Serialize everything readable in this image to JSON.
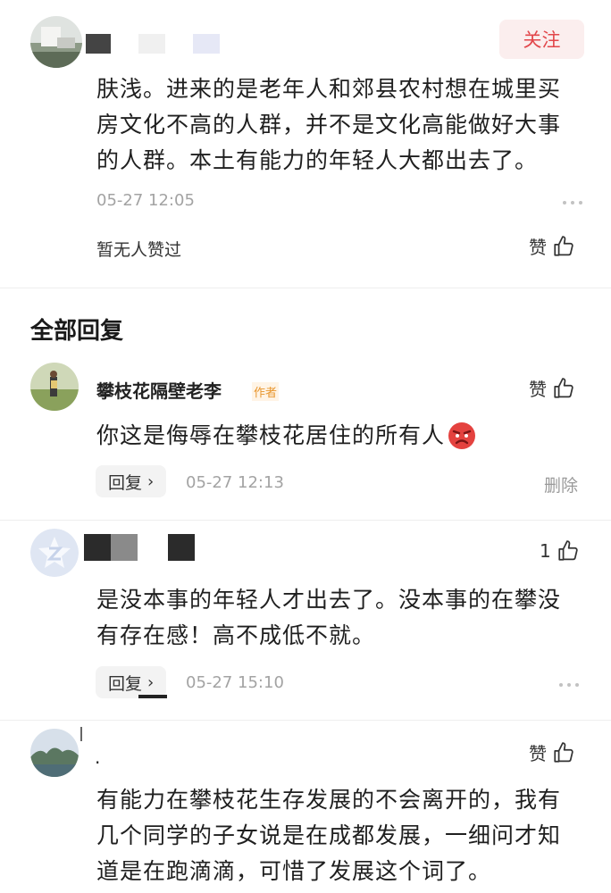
{
  "top_comment": {
    "follow_label": "关注",
    "text_lines": [
      "肤浅。进来的是老年人和郊县农村想在城里买",
      "房文化不高的人群，并不是文化高能做好大事",
      "的人群。本土有能力的年轻人大都出去了。"
    ],
    "timestamp": "05-27 12:05",
    "likes_summary": "暂无人赞过",
    "like_label": "赞"
  },
  "section_title": "全部回复",
  "replies": [
    {
      "name": "攀枝花隔壁老李",
      "author_badge": "作者",
      "like_label": "赞",
      "text_lines": [
        "你这是侮辱在攀枝花居住的所有人"
      ],
      "emoji": "angry-emoji",
      "reply_label": "回复",
      "timestamp": "05-27 12:13",
      "delete_label": "删除"
    },
    {
      "like_count": "1",
      "text_lines": [
        "是没本事的年轻人才出去了。没本事的在攀没",
        "有存在感！高不成低不就。"
      ],
      "reply_label": "回复",
      "timestamp": "05-27 15:10"
    },
    {
      "name": ".",
      "like_label": "赞",
      "text_lines": [
        "有能力在攀枝花生存发展的不会离开的，我有",
        "几个同学的子女说是在成都发展，一细问才知",
        "道是在跑滴滴，可惜了发展这个词了。"
      ]
    }
  ],
  "icons": [
    "thumbs-up-icon",
    "chevron-right-icon",
    "more-dots-icon",
    "angry-emoji"
  ],
  "colors": {
    "follow_text": "#e2474b",
    "follow_bg": "#fbeeee",
    "author_badge": "#e8962e",
    "meta_gray": "#a3a3a3"
  }
}
